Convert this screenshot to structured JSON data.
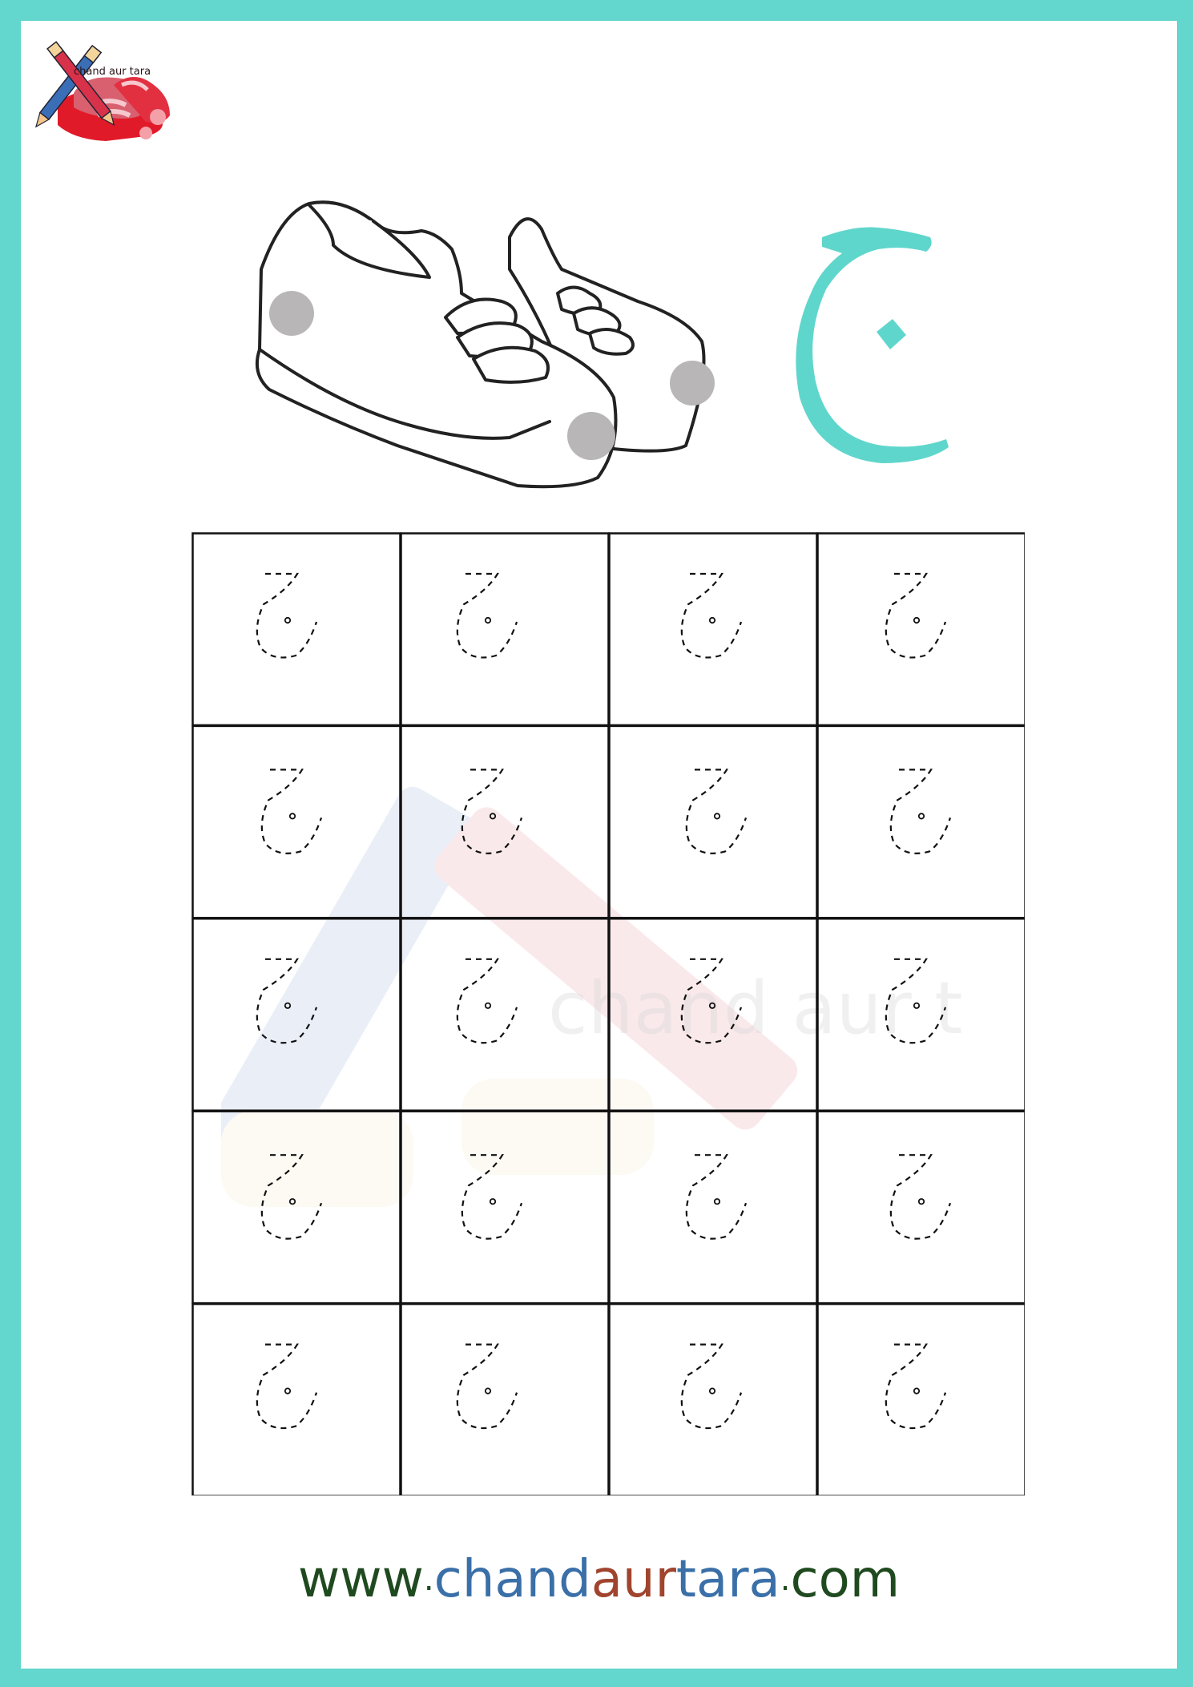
{
  "brand": {
    "logo_text": "chand aur tara"
  },
  "letter": {
    "glyph": "ج",
    "color": "#5fd6cc"
  },
  "grid": {
    "rows": 5,
    "cols": 4,
    "trace_glyph": "ج"
  },
  "watermark": {
    "text": "chand aur t"
  },
  "footer": {
    "url_parts": [
      {
        "text": "www",
        "color": "#1f4a1f"
      },
      {
        "text": ".",
        "color": "#1f4a1f"
      },
      {
        "text": "chand",
        "color": "#3a6fa8"
      },
      {
        "text": "aur",
        "color": "#a0442e"
      },
      {
        "text": "tara",
        "color": "#3a6fa8"
      },
      {
        "text": ".",
        "color": "#1f4a1f"
      },
      {
        "text": "com",
        "color": "#1f4a1f"
      }
    ]
  },
  "colors": {
    "border": "#63d6cd",
    "accent": "#5fd6cc"
  }
}
